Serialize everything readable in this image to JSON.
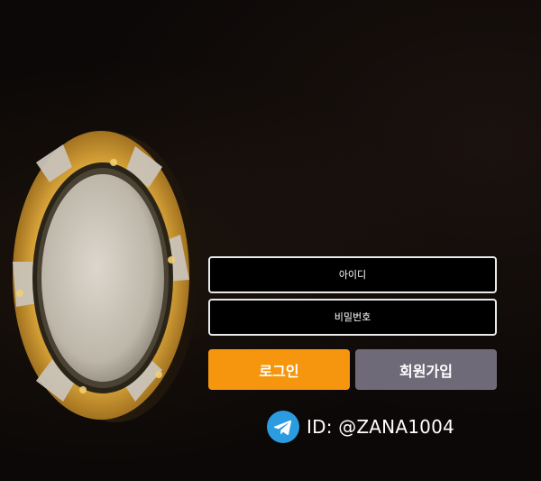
{
  "login_form": {
    "id_placeholder": "아이디",
    "password_placeholder": "비밀번호",
    "login_label": "로그인",
    "signup_label": "회원가입"
  },
  "contact": {
    "icon": "telegram-icon",
    "text": "ID: @ZANA1004"
  },
  "colors": {
    "login_button": "#f6960e",
    "signup_button": "#6e6a78",
    "telegram": "#2c9ce0",
    "background": "#0b0807",
    "chip_gold": "#e4b54a",
    "chip_silver": "#cfcac0"
  }
}
